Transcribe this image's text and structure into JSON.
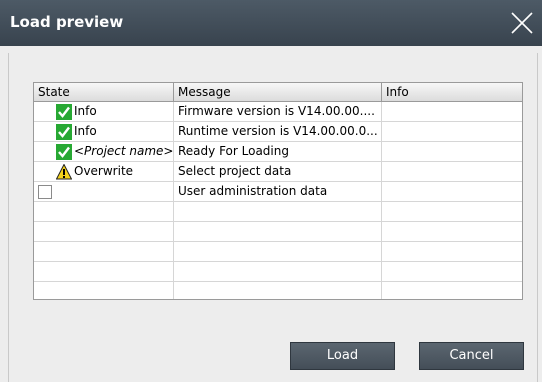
{
  "dialog": {
    "title": "Load preview"
  },
  "table": {
    "headers": [
      "State",
      "Message",
      "Info"
    ],
    "rows": [
      {
        "icon": "check",
        "state": "Info",
        "state_italic": false,
        "message": "Firmware version is V14.00.00....",
        "info": ""
      },
      {
        "icon": "check",
        "state": "Info",
        "state_italic": false,
        "message": "Runtime version is V14.00.00.0...",
        "info": ""
      },
      {
        "icon": "check",
        "state": "<Project name>",
        "state_italic": true,
        "message": "Ready For Loading",
        "info": ""
      },
      {
        "icon": "warning",
        "state": "Overwrite",
        "state_italic": false,
        "message": "Select project data",
        "info": ""
      },
      {
        "icon": "checkbox",
        "state": "",
        "state_italic": false,
        "message": "User administration data",
        "info": ""
      },
      {
        "icon": "",
        "state": "",
        "state_italic": false,
        "message": "",
        "info": ""
      },
      {
        "icon": "",
        "state": "",
        "state_italic": false,
        "message": "",
        "info": ""
      },
      {
        "icon": "",
        "state": "",
        "state_italic": false,
        "message": "",
        "info": ""
      },
      {
        "icon": "",
        "state": "",
        "state_italic": false,
        "message": "",
        "info": ""
      },
      {
        "icon": "",
        "state": "",
        "state_italic": false,
        "message": "",
        "info": ""
      }
    ]
  },
  "buttons": {
    "load": "Load",
    "cancel": "Cancel"
  },
  "colors": {
    "titlebar": "#3f4a55",
    "button": "#4f5a64",
    "check_green": "#27a833",
    "warning_yellow": "#f3d11b"
  }
}
